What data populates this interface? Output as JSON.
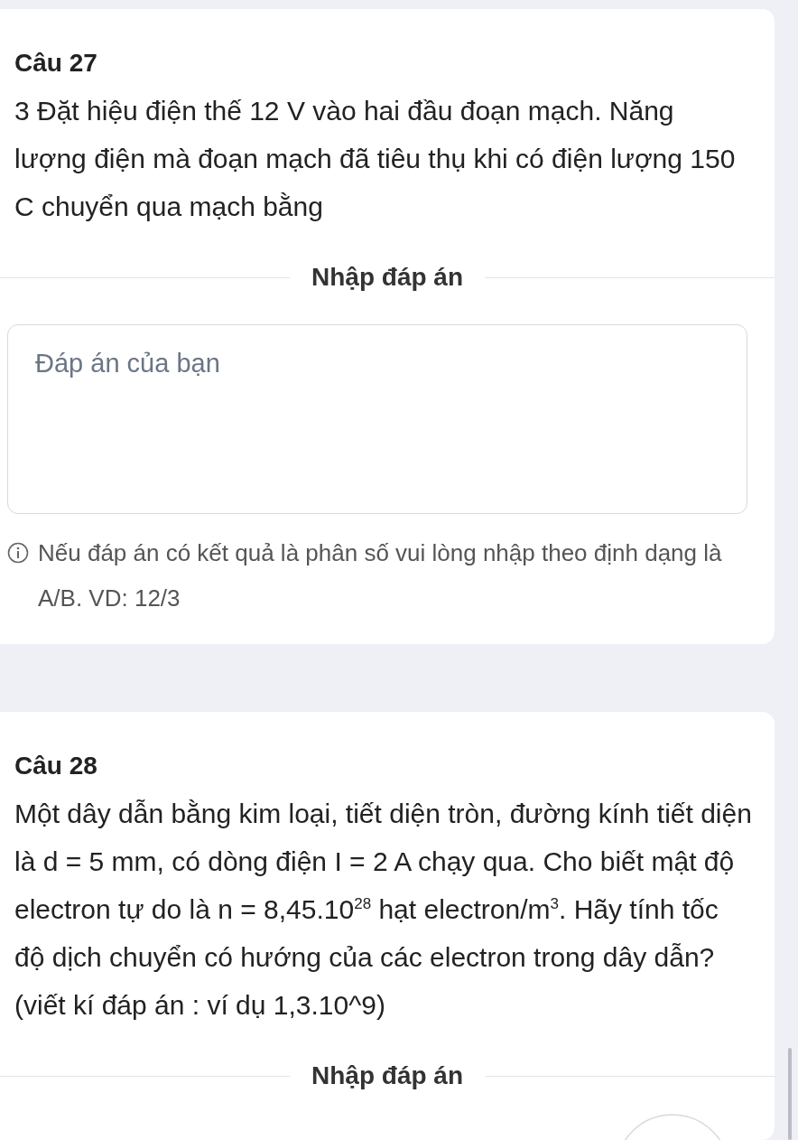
{
  "questions": [
    {
      "title": "Câu 27",
      "text": "3 Đặt hiệu điện thế 12 V vào hai đầu đoạn mạch. Năng lượng điện mà đoạn mạch đã tiêu thụ khi có điện lượng 150 C chuyển qua mạch bằng",
      "answer_heading": "Nhập đáp án",
      "answer_field": {
        "placeholder": "Đáp án của bạn"
      },
      "note": "Nếu đáp án có kết quả là phân số vui lòng nhập theo định dạng là A/B. VD: 12/3"
    },
    {
      "title": "Câu 28",
      "text": "Một dây dẫn bằng kim loại, tiết diện tròn, đường kính tiết diện là d = 5 mm, có dòng điện I = 2 A chạy qua. Cho biết mật độ electron tự do là n = 8,45.10$^{28}$ hạt electron/m$^{3}$. Hãy tính tốc độ dịch chuyển có hướng của các electron trong dây dẫn? (viết kí đáp án : ví dụ 1,3.10^9)",
      "answer_heading": "Nhập đáp án"
    }
  ]
}
